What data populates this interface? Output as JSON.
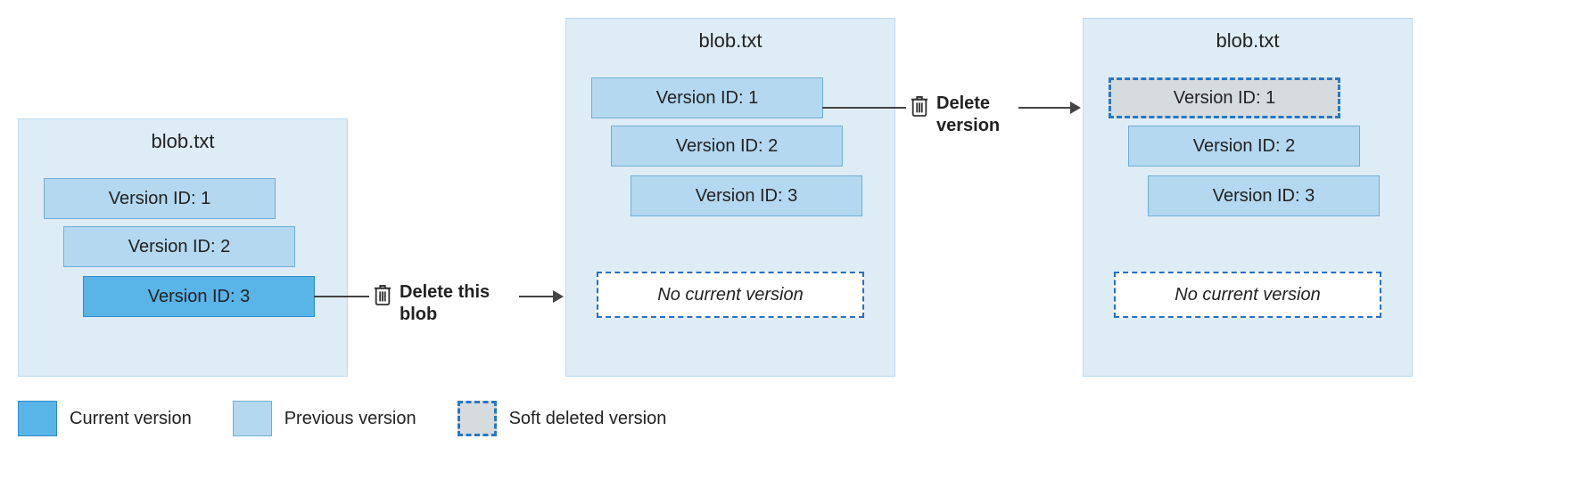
{
  "panels": {
    "a": {
      "title": "blob.txt",
      "versions": {
        "v1": "Version ID: 1",
        "v2": "Version ID: 2",
        "v3": "Version ID: 3"
      }
    },
    "b": {
      "title": "blob.txt",
      "versions": {
        "v1": "Version ID: 1",
        "v2": "Version ID: 2",
        "v3": "Version ID: 3"
      },
      "no_current": "No current version"
    },
    "c": {
      "title": "blob.txt",
      "versions": {
        "v1": "Version ID: 1",
        "v2": "Version ID: 2",
        "v3": "Version ID: 3"
      },
      "no_current": "No current version"
    }
  },
  "actions": {
    "delete_blob": "Delete this blob",
    "delete_version": "Delete version"
  },
  "legend": {
    "current": "Current version",
    "previous": "Previous version",
    "soft_deleted": "Soft deleted version"
  }
}
